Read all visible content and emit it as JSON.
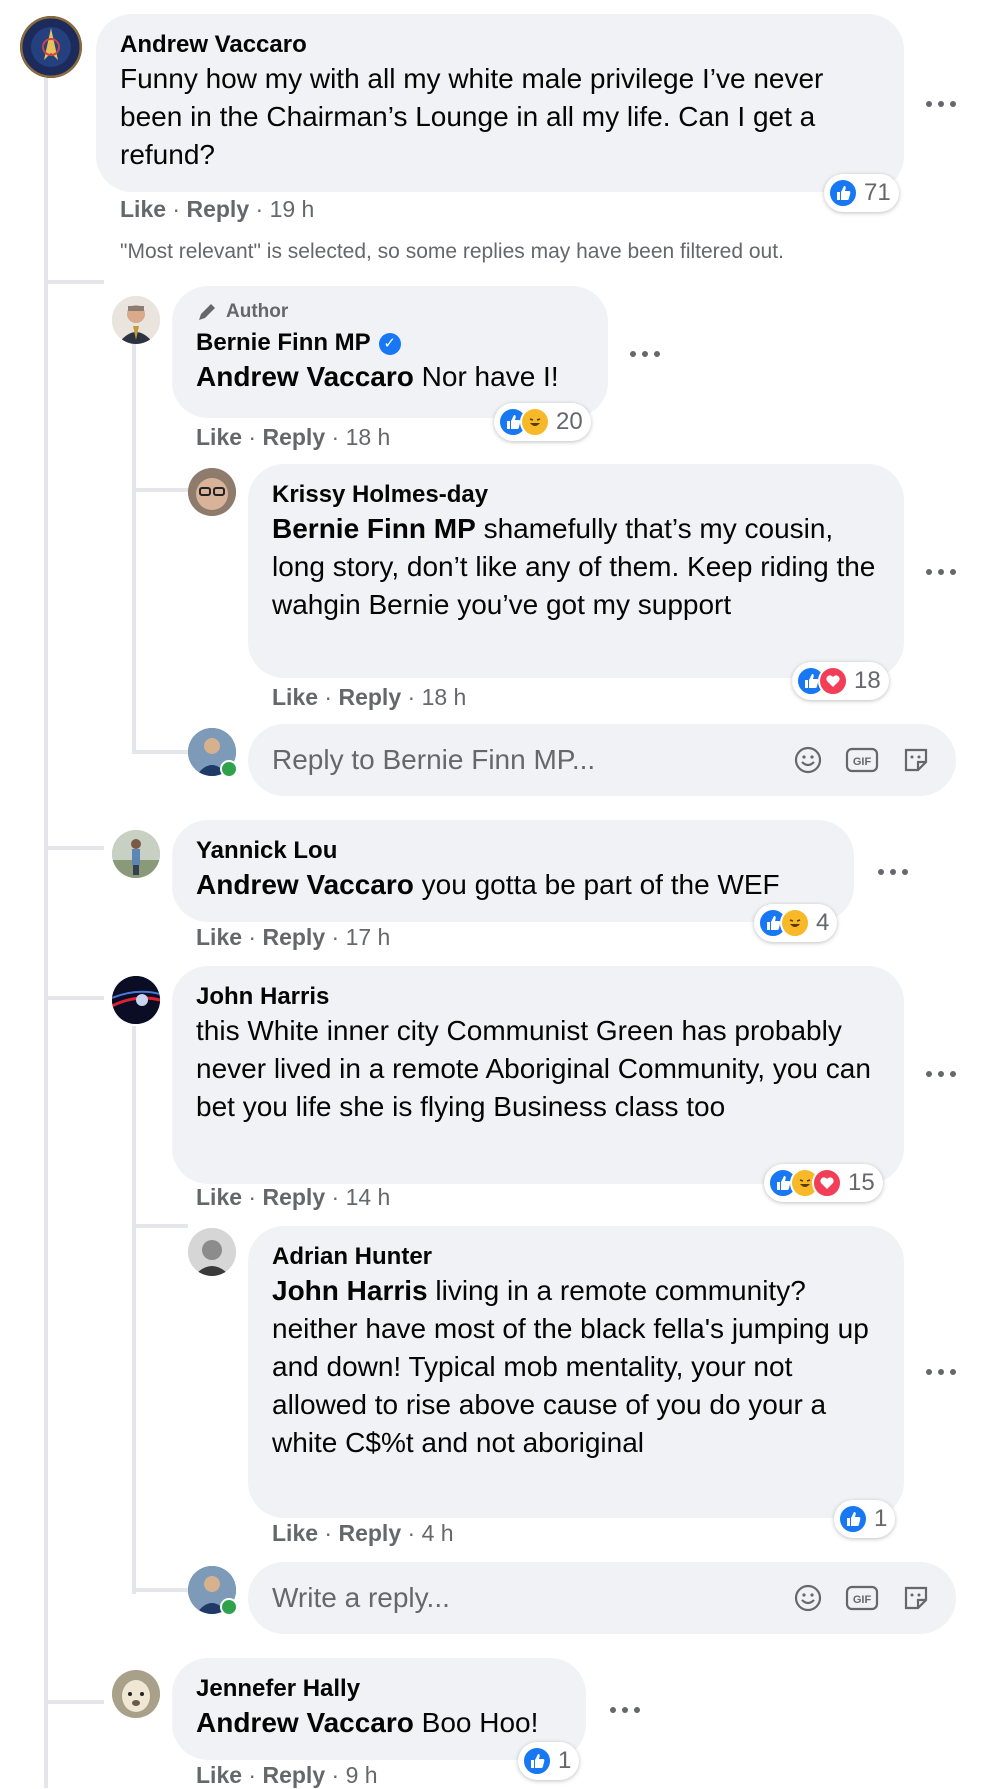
{
  "comments": [
    {
      "name": "Andrew Vaccaro",
      "text": "Funny how my with all my white male privilege I’ve never been in the Chairman’s Lounge in all my life. Can I get a refund?",
      "like": "Like",
      "reply": "Reply",
      "time": "19 h",
      "reactions": "71"
    },
    {
      "author_label": "Author",
      "name": "Bernie Finn MP",
      "mention": "Andrew Vaccaro",
      "text": " Nor have I!",
      "like": "Like",
      "reply": "Reply",
      "time": "18 h",
      "reactions": "20"
    },
    {
      "name": "Krissy Holmes-day",
      "mention": "Bernie Finn MP",
      "text": " shamefully that’s my cousin, long story, don’t like any of them. Keep riding the wahgin Bernie you’ve got my support",
      "like": "Like",
      "reply": "Reply",
      "time": "18 h",
      "reactions": "18"
    },
    {
      "name": "Yannick Lou",
      "mention": "Andrew Vaccaro",
      "text": " you gotta be part of the WEF",
      "like": "Like",
      "reply": "Reply",
      "time": "17 h",
      "reactions": "4"
    },
    {
      "name": "John Harris",
      "text": "this White inner city Communist Green has probably never lived in a remote Aboriginal Community, you can bet you life she is flying Business class too",
      "like": "Like",
      "reply": "Reply",
      "time": "14 h",
      "reactions": "15"
    },
    {
      "name": "Adrian Hunter",
      "mention": "John Harris",
      "text": " living in a remote community? neither have most of the black fella's jumping up and down! Typical mob mentality, your not allowed to rise above cause of you do your a white C$%t and not aboriginal",
      "like": "Like",
      "reply": "Reply",
      "time": "4 h",
      "reactions": "1"
    },
    {
      "name": "Jennefer Hally",
      "mention": "Andrew Vaccaro",
      "text": " Boo Hoo!",
      "like": "Like",
      "reply": "Reply",
      "time": "9 h",
      "reactions": "1"
    }
  ],
  "filter_note": "\"Most relevant\" is selected, so some replies may have been filtered out.",
  "reply_box_1": {
    "placeholder": "Reply to Bernie Finn MP..."
  },
  "reply_box_2": {
    "placeholder": "Write a reply..."
  },
  "separator": "·",
  "icons": {
    "emoji": "emoji-icon",
    "gif": "gif-icon",
    "sticker": "sticker-icon",
    "more": "more-icon",
    "pencil": "pencil-icon",
    "verified": "verified-badge-icon"
  },
  "colors": {
    "bubble": "#f0f2f5",
    "like_blue": "#1877f2",
    "haha_yellow": "#f7b928",
    "love_red": "#f33e58",
    "meta_gray": "#65676b",
    "online_green": "#31a24c"
  }
}
